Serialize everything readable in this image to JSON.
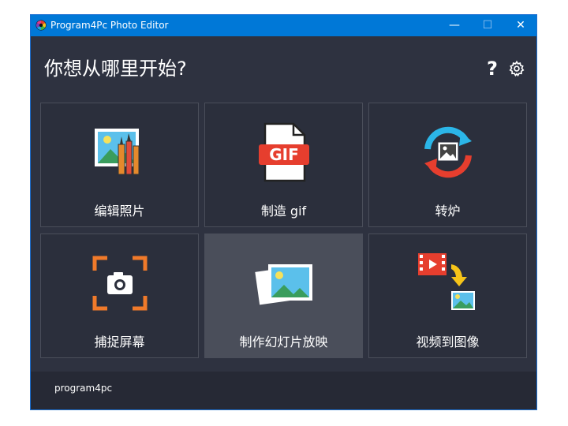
{
  "window": {
    "title": "Program4Pc Photo Editor"
  },
  "titlebar": {
    "minimize": "—",
    "maximize": "☐",
    "close": "✕"
  },
  "heading": "你想从哪里开始?",
  "help": "?",
  "tiles": [
    {
      "label": "编辑照片"
    },
    {
      "label": "制造 gif"
    },
    {
      "label": "转炉"
    },
    {
      "label": "捕捉屏幕"
    },
    {
      "label": "制作幻灯片放映"
    },
    {
      "label": "视频到图像"
    }
  ],
  "gif_text": "GIF",
  "footer": {
    "logo": "program4pc"
  },
  "colors": {
    "titlebar": "#0078d7",
    "background": "#2e3240",
    "tile": "#2b2f3c",
    "tile_active": "#4a4e5a",
    "accent": "#e63e2e"
  }
}
